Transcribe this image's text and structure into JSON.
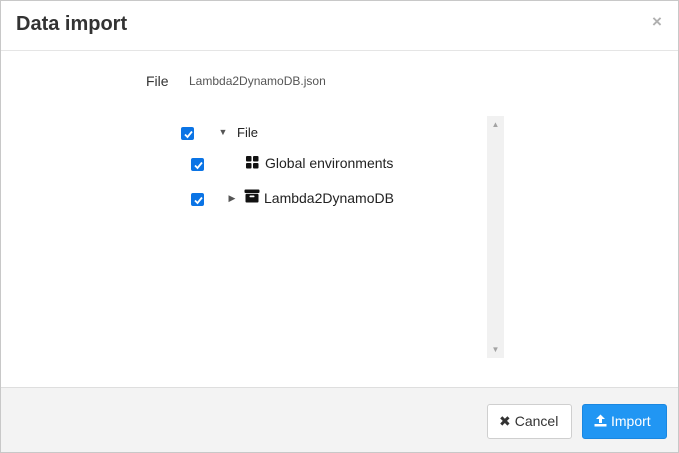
{
  "dialog": {
    "title": "Data import",
    "close_glyph": "×"
  },
  "file": {
    "label": "File",
    "value": "Lambda2DynamoDB.json"
  },
  "tree": {
    "root": {
      "label": "File",
      "checked": true,
      "expanded": true
    },
    "children": [
      {
        "label": "Global environments",
        "checked": true,
        "icon": "grid-icon",
        "expandable": false
      },
      {
        "label": "Lambda2DynamoDB",
        "checked": true,
        "icon": "archive-icon",
        "expandable": true,
        "expanded": false
      }
    ]
  },
  "footer": {
    "cancel_label": "Cancel",
    "cancel_icon": "times-icon",
    "import_label": "Import",
    "import_icon": "upload-icon"
  },
  "colors": {
    "checkbox": "#0b74e5",
    "primary_button": "#2196f3"
  }
}
